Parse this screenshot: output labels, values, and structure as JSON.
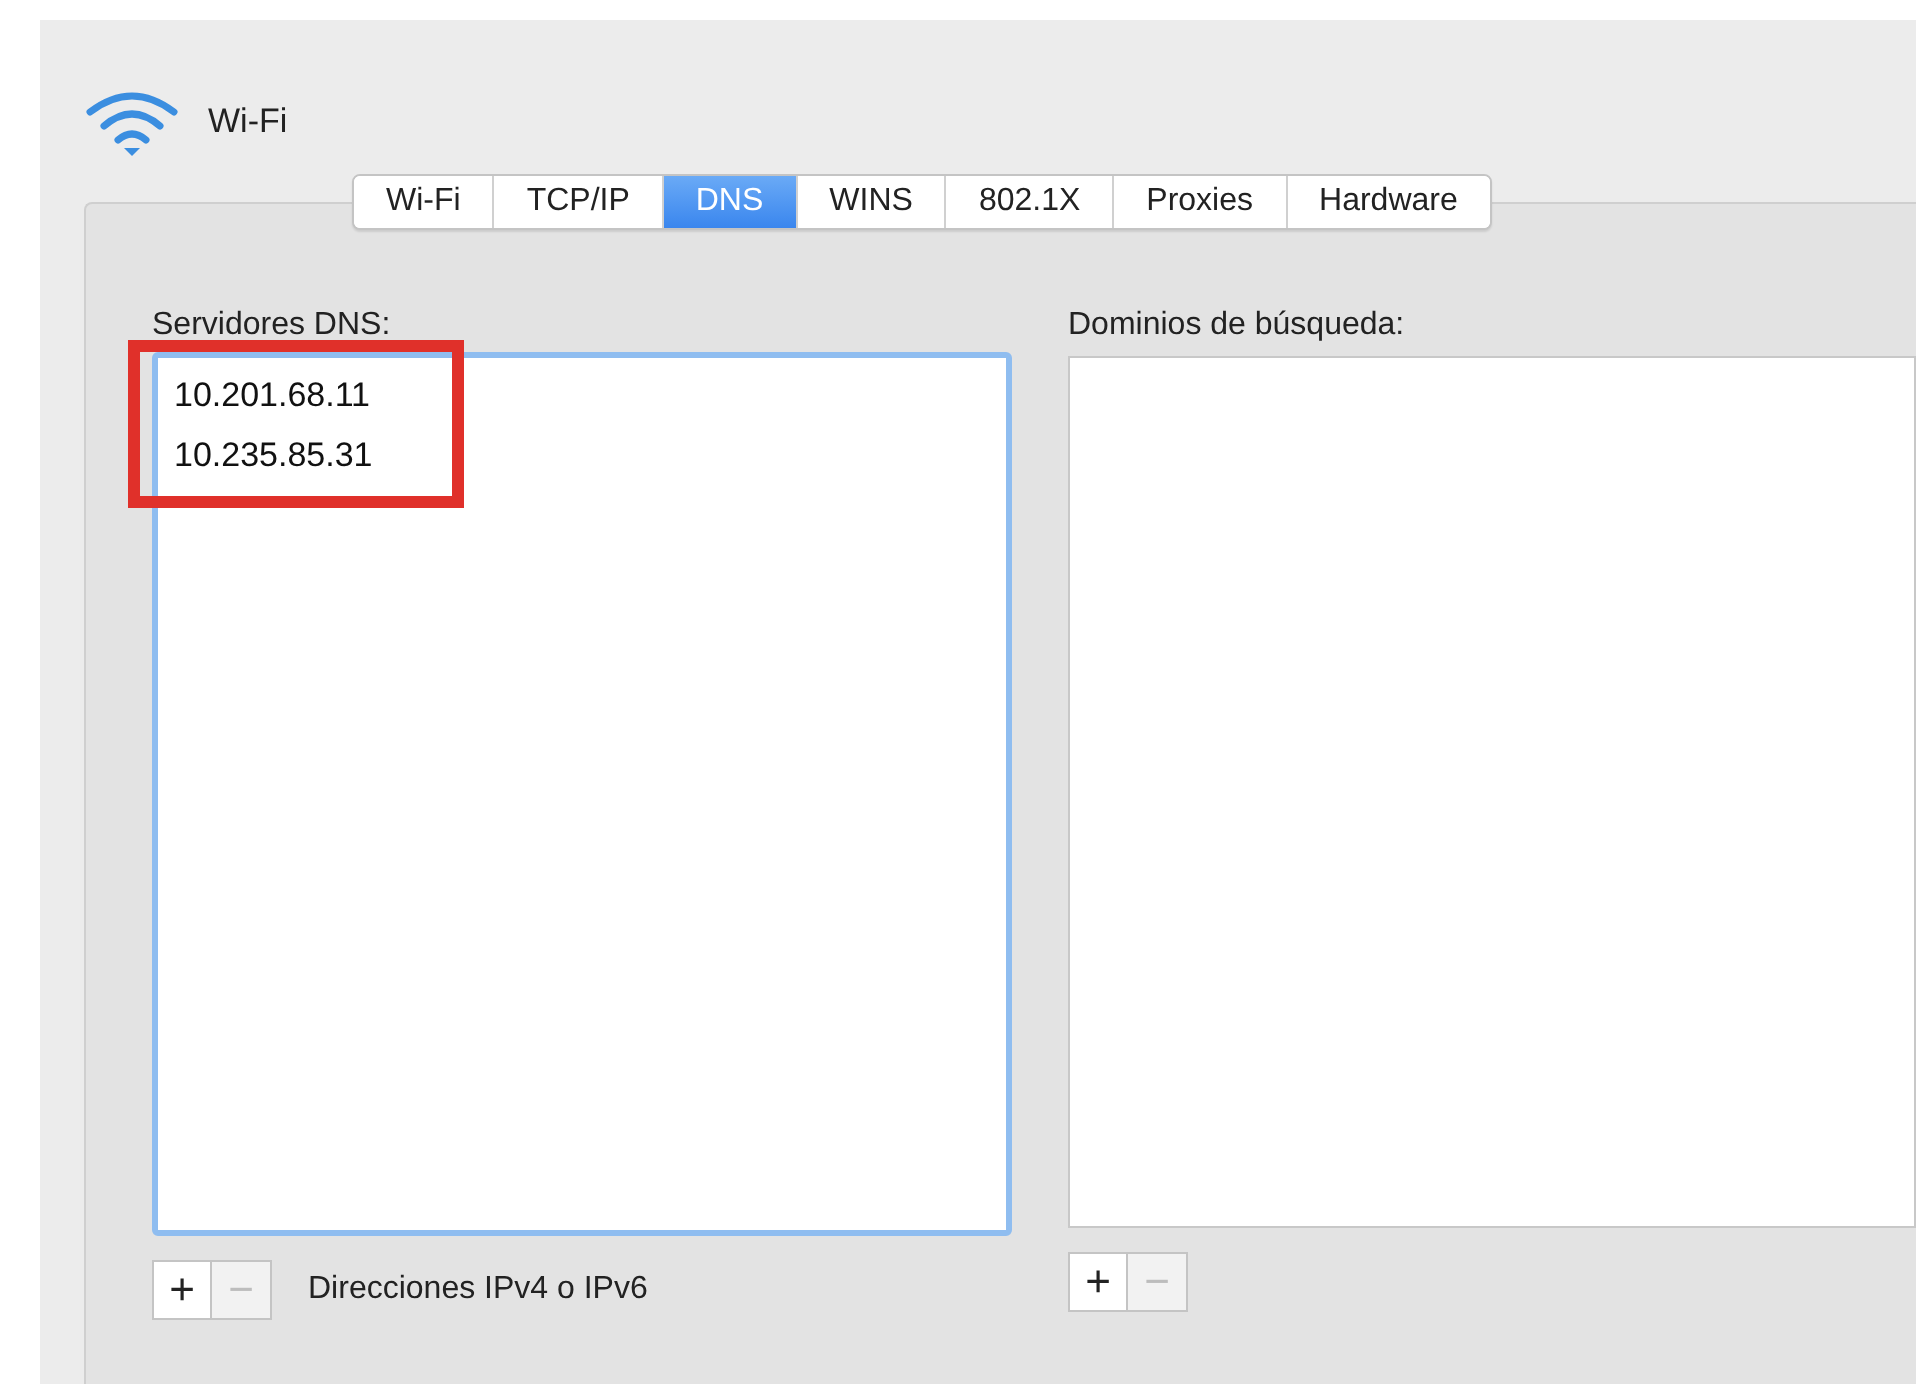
{
  "window": {
    "title": "Wi-Fi"
  },
  "tabs": [
    {
      "label": "Wi-Fi",
      "selected": false
    },
    {
      "label": "TCP/IP",
      "selected": false
    },
    {
      "label": "DNS",
      "selected": true
    },
    {
      "label": "WINS",
      "selected": false
    },
    {
      "label": "802.1X",
      "selected": false
    },
    {
      "label": "Proxies",
      "selected": false
    },
    {
      "label": "Hardware",
      "selected": false
    }
  ],
  "dns_servers": {
    "label": "Servidores DNS:",
    "focused": true,
    "highlighted": true,
    "items": [
      "10.201.68.11",
      "10.235.85.31"
    ],
    "buttons": [
      {
        "label": "+",
        "disabled": false
      },
      {
        "label": "−",
        "disabled": true
      }
    ],
    "hint": "Direcciones IPv4 o IPv6"
  },
  "search_domains": {
    "label": "Dominios de búsqueda:",
    "focused": false,
    "buttons": [
      {
        "label": "+",
        "disabled": false
      },
      {
        "label": "−",
        "disabled": true
      }
    ]
  }
}
